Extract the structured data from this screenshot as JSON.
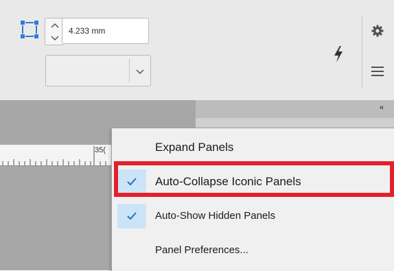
{
  "controlbar": {
    "spacing_value": "4.233 mm",
    "dropdown_value": ""
  },
  "icons": {
    "spacing": "spacing-icon",
    "stepper_up": "chevron-up-icon",
    "stepper_down": "chevron-down-icon",
    "dropdown": "chevron-down-icon",
    "lightning": "lightning-icon",
    "gear": "gear-icon",
    "menu": "hamburger-icon",
    "collapse": "double-chevron-left-icon",
    "check": "checkmark-icon"
  },
  "panel": {
    "collapse_glyph": "«"
  },
  "ruler": {
    "label": "35("
  },
  "menu": {
    "items": [
      {
        "label": "Expand Panels",
        "checked": false
      },
      {
        "label": "Auto-Collapse Iconic Panels",
        "checked": true
      },
      {
        "label": "Auto-Show Hidden Panels",
        "checked": true
      },
      {
        "label": "Panel Preferences...",
        "checked": false
      }
    ]
  },
  "colors": {
    "highlight": "#e3202b",
    "check_bg": "#cce4f7",
    "check_mark": "#2a6ebb",
    "icon_blue": "#2d7bd8"
  }
}
